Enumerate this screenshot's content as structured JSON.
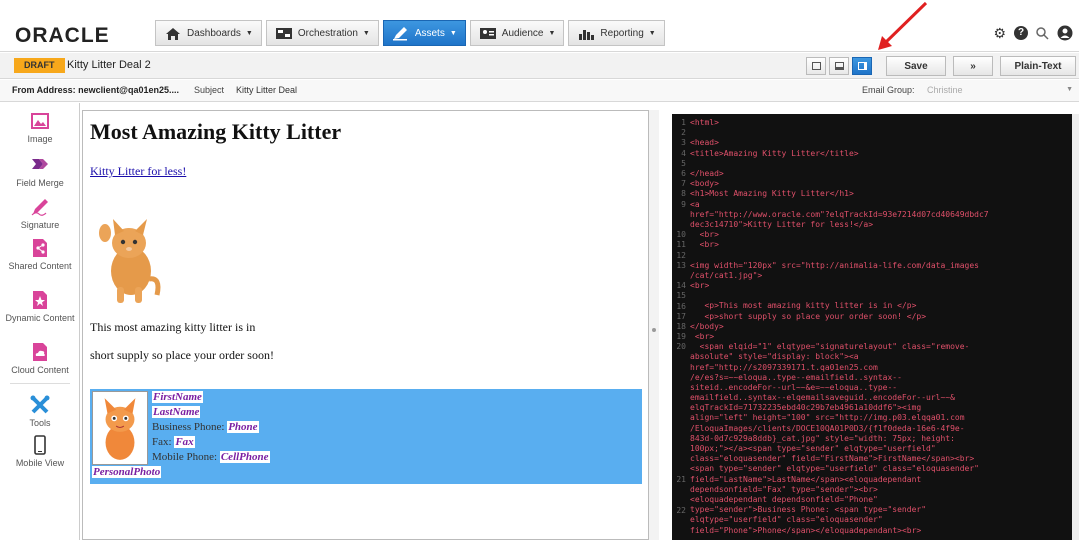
{
  "brand": {
    "logo": "ORACLE"
  },
  "nav": [
    {
      "label": "Dashboards",
      "icon": "house-icon",
      "active": false
    },
    {
      "label": "Orchestration",
      "icon": "flow-icon",
      "active": false
    },
    {
      "label": "Assets",
      "icon": "pencil-icon",
      "active": true
    },
    {
      "label": "Audience",
      "icon": "audience-icon",
      "active": false
    },
    {
      "label": "Reporting",
      "icon": "chart-icon",
      "active": false
    }
  ],
  "top_icons": {
    "settings": "⚙",
    "help": "❓",
    "search": "🔍",
    "user": "●"
  },
  "deal": {
    "status": "DRAFT",
    "name": "Kitty Litter Deal 2"
  },
  "actions": {
    "save": "Save",
    "next": "»",
    "plain_text": "Plain-Text"
  },
  "address": {
    "from": "From Address: newclient@qa01en25....",
    "subject_label": "Subject",
    "subject": "Kitty Litter Deal",
    "group_label": "Email Group:",
    "group": "Christine"
  },
  "tools": [
    {
      "label": "Image",
      "icon": "image-icon"
    },
    {
      "label": "Field Merge",
      "icon": "field-merge-icon"
    },
    {
      "label": "Signature",
      "icon": "signature-icon"
    },
    {
      "label": "Shared Content",
      "icon": "shared-content-icon"
    },
    {
      "label": "Dynamic Content",
      "icon": "dynamic-content-icon"
    },
    {
      "label": "Cloud Content",
      "icon": "cloud-content-icon"
    },
    {
      "label": "Tools",
      "icon": "tools-icon"
    },
    {
      "label": "Mobile View",
      "icon": "mobile-icon"
    }
  ],
  "email": {
    "heading": "Most Amazing Kitty Litter",
    "link": "Kitty Litter for less!",
    "para1": "This most amazing kitty litter is in",
    "para2": "short supply so place your order soon!",
    "signature": {
      "first": "FirstName",
      "last": "LastName",
      "bp_label": "Business Phone:",
      "bp": "Phone",
      "fax_label": "Fax:",
      "fax": "Fax",
      "mp_label": "Mobile Phone:",
      "mp": "CellPhone",
      "photo": "PersonalPhoto"
    }
  },
  "code": {
    "gutter": "1\n2\n3\n4\n5\n6\n7\n8\n9\n\n\n10\n11\n12\n13\n\n14\n15\n16\n17\n18\n19\n20\n\n\n\n\n\n\n\n\n\n\n\n\n21\n\n\n22\n\n\n\n\n23",
    "lines": [
      "<html>",
      "",
      "<head>",
      "<title>Amazing Kitty Litter</title>",
      "",
      "</head>",
      "<body>",
      "<h1>Most Amazing Kitty Litter</h1>",
      "<a",
      "href=\"http://www.oracle.com\"?elqTrackId=93e7214d07cd40649dbdc7",
      "dec3c14710\">Kitty Litter for less!</a>",
      "  <br>",
      "  <br>",
      "",
      "<img width=\"120px\" src=\"http://animalia-life.com/data_images",
      "/cat/cat1.jpg\">",
      "<br>",
      "",
      "   <p>This most amazing kitty litter is in </p>",
      "   <p>short supply so place your order soon! </p>",
      "</body>",
      " <br>",
      "  <span elqid=\"1\" elqtype=\"signaturelayout\" class=\"remove-",
      "absolute\" style=\"display: block\"><a",
      "href=\"http://s2097339171.t.qa01en25.com",
      "/e/es?s=~~eloqua..type--emailfield..syntax--",
      "siteid..encodeFor--url~~&e=~~eloqua..type--",
      "emailfield..syntax--elqemailsaveguid..encodeFor--url~~&",
      "elqTrackId=71732235ebd40c29b7eb4961a10ddf6\"><img",
      "align=\"left\" height=\"100\" src=\"http://img.p03.elqqa01.com",
      "/EloquaImages/clients/DOCE10QA01P0D3/{f1f0deda-16e6-4f9e-",
      "843d-0d7c929a8ddb}_cat.jpg\" style=\"width: 75px; height:",
      "100px;\"></a><span type=\"sender\" elqtype=\"userfield\"",
      "class=\"eloquasender\" field=\"FirstName\">FirstName</span><br>",
      "<span type=\"sender\" elqtype=\"userfield\" class=\"eloquasender\"",
      "field=\"LastName\">LastName</span><eloquadependant",
      "dependsonfield=\"Fax\" type=\"sender\"><br>",
      "<eloquadependant dependsonfield=\"Phone\"",
      "type=\"sender\">Business Phone: <span type=\"sender\"",
      "elqtype=\"userfield\" class=\"eloquasender\"",
      "field=\"Phone\">Phone</span></eloquadependant><br>"
    ]
  },
  "colors": {
    "accent": "#1f74c9",
    "draft": "#f7a81b",
    "signature_bg": "#59aef0",
    "tool_icon": "#d9449a",
    "code_bg": "#111111",
    "code_tag": "#e0506a"
  }
}
